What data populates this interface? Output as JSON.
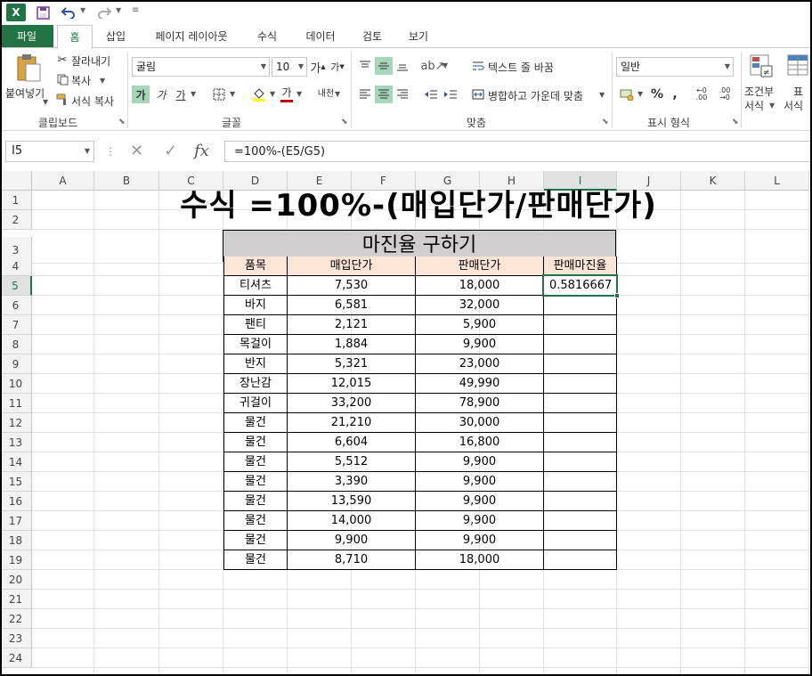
{
  "qat": {
    "logo": "X",
    "save_icon": "save-icon",
    "undo_icon": "undo-icon",
    "redo_icon": "redo-icon"
  },
  "tabs": [
    "파일",
    "홈",
    "삽입",
    "페이지 레이아웃",
    "수식",
    "데이터",
    "검토",
    "보기"
  ],
  "ribbon": {
    "clipboard": {
      "paste": "붙여넣기",
      "cut": "잘라내기",
      "copy": "복사",
      "format_painter": "서식 복사",
      "label": "클립보드"
    },
    "font": {
      "name": "굴림",
      "size": "10",
      "grow": "가",
      "shrink": "가",
      "bold": "가",
      "italic": "가",
      "underline": "가",
      "fill": "",
      "color": "가",
      "phonetic": "내천",
      "label": "글꼴"
    },
    "alignment": {
      "wrap": "텍스트 줄 바꿈",
      "merge": "병합하고 가운데 맞춤",
      "label": "맞춤"
    },
    "number": {
      "format": "일반",
      "percent": "%",
      "comma": ",",
      "inc": "←0 .00",
      "dec": ".00 →0",
      "label": "표시 형식"
    },
    "styles": {
      "cond": "조건부",
      "cond2": "서식",
      "table": "표",
      "table2": "서식"
    }
  },
  "formula_bar": {
    "name_box": "I5",
    "fx": "fx",
    "formula": "=100%-(E5/G5)"
  },
  "columns": [
    "A",
    "B",
    "C",
    "D",
    "E",
    "F",
    "G",
    "H",
    "I",
    "J",
    "K",
    "L"
  ],
  "rows": [
    "1",
    "2",
    "3",
    "4",
    "5",
    "6",
    "7",
    "8",
    "9",
    "10",
    "11",
    "12",
    "13",
    "14",
    "15",
    "16",
    "17",
    "18",
    "19",
    "20",
    "21",
    "22",
    "23",
    "24"
  ],
  "sheet": {
    "big_title": "수식 =100%-(매입단가/판매단가)",
    "table_title": "마진율 구하기",
    "headers": [
      "품목",
      "매입단가",
      "판매단가",
      "판매마진율"
    ],
    "items": [
      [
        "티셔츠",
        "7,530",
        "18,000",
        "0.5816667"
      ],
      [
        "바지",
        "6,581",
        "32,000",
        ""
      ],
      [
        "팬티",
        "2,121",
        "5,900",
        ""
      ],
      [
        "목걸이",
        "1,884",
        "9,900",
        ""
      ],
      [
        "반지",
        "5,321",
        "23,000",
        ""
      ],
      [
        "장난감",
        "12,015",
        "49,990",
        ""
      ],
      [
        "귀걸이",
        "33,200",
        "78,900",
        ""
      ],
      [
        "물건",
        "21,210",
        "30,000",
        ""
      ],
      [
        "물건",
        "6,604",
        "16,800",
        ""
      ],
      [
        "물건",
        "5,512",
        "9,900",
        ""
      ],
      [
        "물건",
        "3,390",
        "9,900",
        ""
      ],
      [
        "물건",
        "13,590",
        "9,900",
        ""
      ],
      [
        "물건",
        "14,000",
        "9,900",
        ""
      ],
      [
        "물건",
        "9,900",
        "9,900",
        ""
      ],
      [
        "물건",
        "8,710",
        "18,000",
        ""
      ]
    ]
  }
}
